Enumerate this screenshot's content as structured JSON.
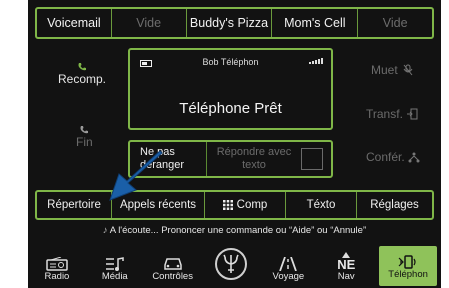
{
  "favorites": [
    "Voicemail",
    "Vide",
    "Buddy's Pizza",
    "Mom's Cell",
    "Vide"
  ],
  "left_buttons": {
    "redial": "Recomp.",
    "end": "Fin"
  },
  "right_buttons": {
    "mute": "Muet",
    "transfer": "Transf.",
    "conference": "Confér."
  },
  "status": {
    "caller": "Bob Téléphon",
    "ready": "Téléphone Prêt"
  },
  "reply": {
    "do_not_disturb": "Ne pas déranger",
    "reply_text": "Répondre avec texto"
  },
  "tabs": [
    "Répertoire",
    "Appels récents",
    "Comp",
    "Téxto",
    "Réglages"
  ],
  "voice_prompt": "A l'écoute... Prononcer une commande ou “Aide” ou “Annule”",
  "nav": [
    "Radio",
    "Média",
    "Contrôles",
    "",
    "Voyage",
    "Nav",
    "Téléphon"
  ],
  "compass": "NE",
  "colors": {
    "accent": "#7fb648",
    "active_tab": "#8fc25a",
    "arrow": "#1a5fa8"
  }
}
